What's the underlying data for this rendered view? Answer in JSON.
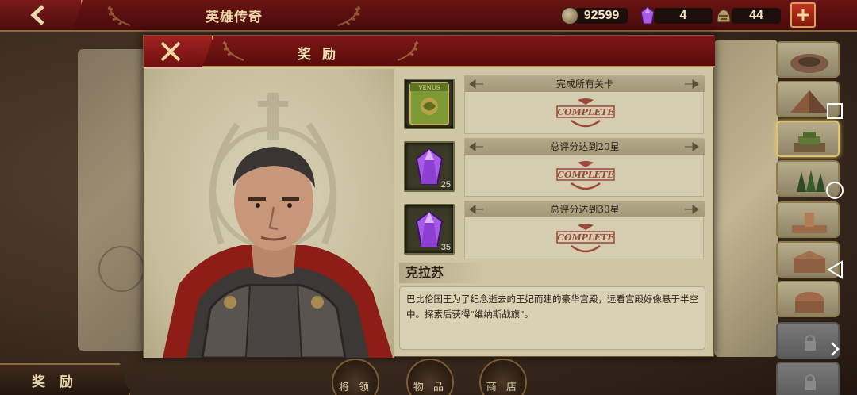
{
  "topbar": {
    "title": "英雄传奇",
    "coins": "92599",
    "gems": "4",
    "troops": "44"
  },
  "dialog": {
    "title": "奖 励",
    "rewards": [
      {
        "label": "完成所有关卡",
        "icon": "venus-banner-icon",
        "count": "",
        "status": "COMPLETE"
      },
      {
        "label": "总评分达到20星",
        "icon": "purple-gem-icon",
        "count": "25",
        "status": "COMPLETE"
      },
      {
        "label": "总评分达到30星",
        "icon": "purple-gem-icon",
        "count": "35",
        "status": "COMPLETE"
      }
    ],
    "banner_text": "VENUS",
    "hero": {
      "name": "克拉苏",
      "description": "巴比伦国王为了纪念逝去的王妃而建的豪华宫殿，远看宫殿好像悬于半空中。探索后获得\"维纳斯战旗\"。"
    }
  },
  "bottom": {
    "tab_label": "奖 励",
    "nav": [
      "将 领",
      "物 品",
      "商 店"
    ]
  },
  "colors": {
    "header_red": "#7d1616",
    "gold_trim": "#b48c4a",
    "parchment": "#cfc6a6",
    "gem_purple": "#a75be6"
  }
}
